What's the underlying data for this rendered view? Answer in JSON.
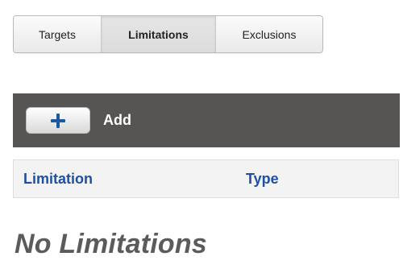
{
  "tabs": [
    {
      "label": "Targets",
      "selected": false
    },
    {
      "label": "Limitations",
      "selected": true
    },
    {
      "label": "Exclusions",
      "selected": false
    }
  ],
  "toolbar": {
    "add_label": "Add",
    "add_icon": "plus-icon"
  },
  "table": {
    "headers": [
      "Limitation",
      "Type"
    ]
  },
  "empty_state": {
    "message": "No Limitations"
  },
  "colors": {
    "toolbar_bg": "#575553",
    "header_text": "#1f4fa0",
    "icon_blue": "#1b5aa3"
  }
}
